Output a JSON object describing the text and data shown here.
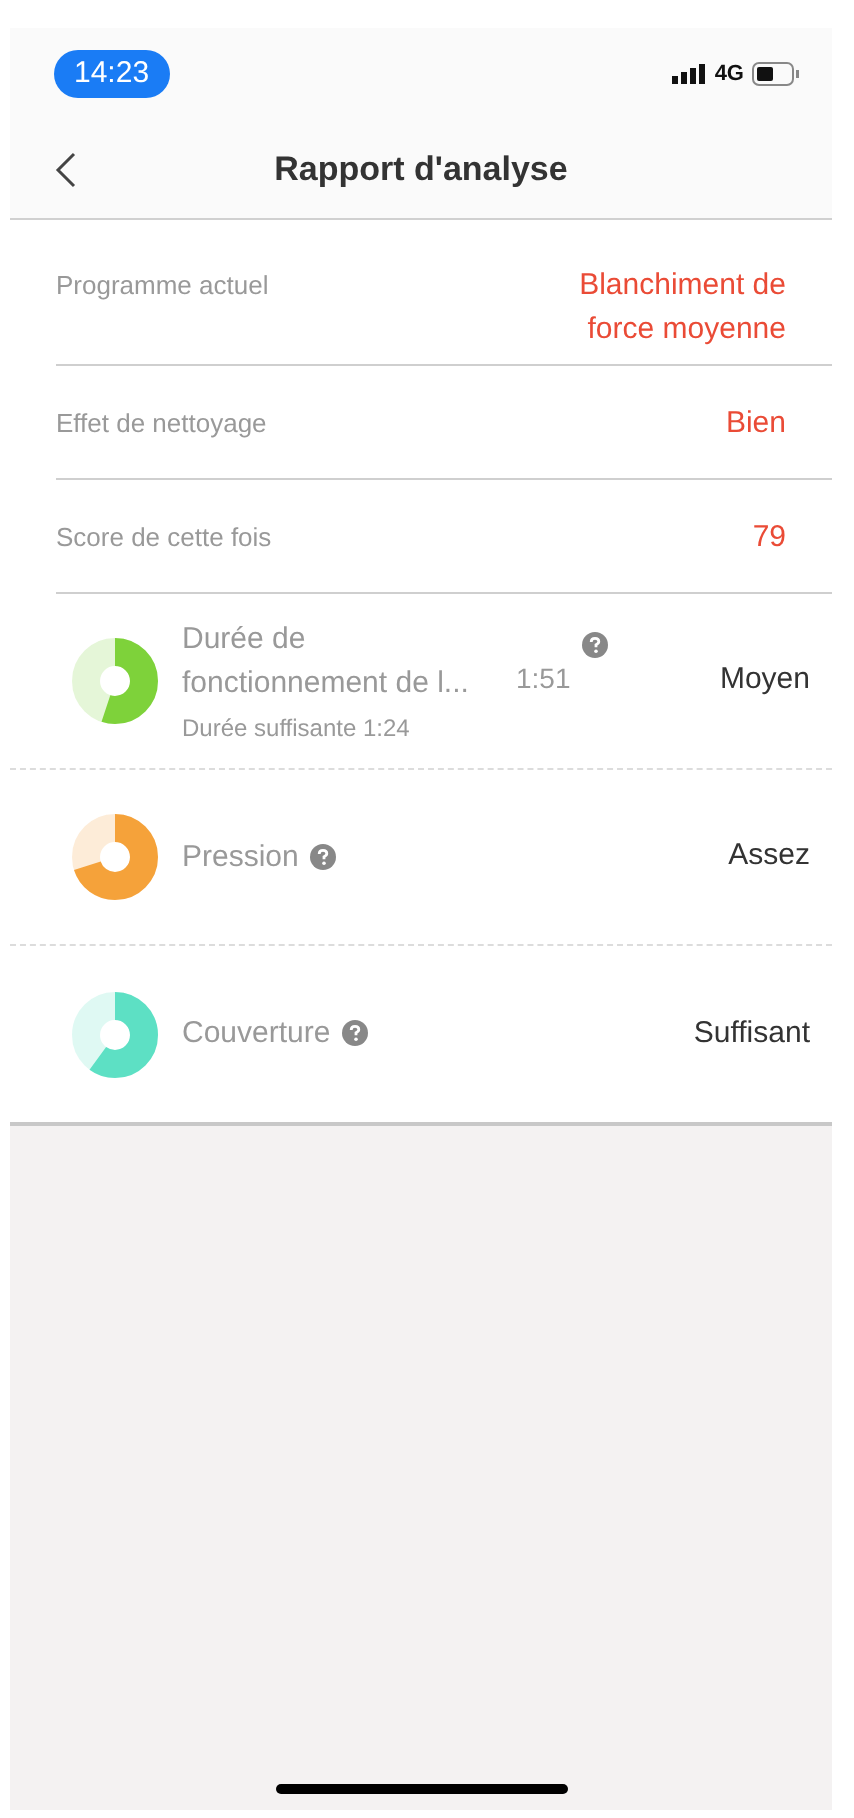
{
  "status_bar": {
    "time": "14:23",
    "network": "4G"
  },
  "header": {
    "title": "Rapport d'analyse"
  },
  "summary": [
    {
      "label": "Programme actuel",
      "value": "Blanchiment de force moyenne"
    },
    {
      "label": "Effet de nettoyage",
      "value": "Bien"
    },
    {
      "label": "Score de cette fois",
      "value": "79"
    }
  ],
  "metrics": [
    {
      "label": "Durée de fonctionnement de l...",
      "reading": "1:51",
      "subtitle": "Durée suffisante 1:24",
      "rating": "Moyen",
      "level": 0.55,
      "color": "#7ed23a"
    },
    {
      "label": "Pression",
      "rating": "Assez",
      "level": 0.7,
      "color": "#f5a23a"
    },
    {
      "label": "Couverture",
      "rating": "Suffisant",
      "level": 0.6,
      "color": "#5de0c4"
    }
  ]
}
